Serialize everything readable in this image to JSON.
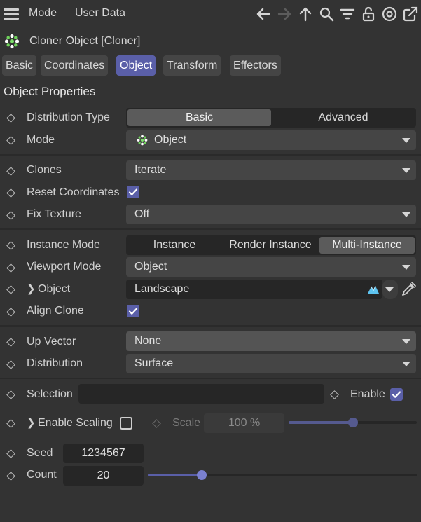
{
  "menu": {
    "mode": "Mode",
    "user_data": "User Data"
  },
  "title": "Cloner Object [Cloner]",
  "tabs": [
    {
      "label": "Basic",
      "active": false
    },
    {
      "label": "Coordinates",
      "active": false
    },
    {
      "label": "Object",
      "active": true
    },
    {
      "label": "Transform",
      "active": false
    },
    {
      "label": "Effectors",
      "active": false
    }
  ],
  "section_title": "Object Properties",
  "props": {
    "distribution_type": {
      "label": "Distribution Type",
      "options": [
        "Basic",
        "Advanced"
      ],
      "selected": "Basic"
    },
    "mode": {
      "label": "Mode",
      "value": "Object"
    },
    "clones": {
      "label": "Clones",
      "value": "Iterate"
    },
    "reset_coordinates": {
      "label": "Reset Coordinates",
      "checked": true
    },
    "fix_texture": {
      "label": "Fix Texture",
      "value": "Off"
    },
    "instance_mode": {
      "label": "Instance Mode",
      "options": [
        "Instance",
        "Render Instance",
        "Multi-Instance"
      ],
      "selected": "Multi-Instance"
    },
    "viewport_mode": {
      "label": "Viewport Mode",
      "value": "Object"
    },
    "object": {
      "label": "Object",
      "value": "Landscape"
    },
    "align_clone": {
      "label": "Align Clone",
      "checked": true
    },
    "up_vector": {
      "label": "Up Vector",
      "value": "None"
    },
    "distribution": {
      "label": "Distribution",
      "value": "Surface"
    },
    "selection": {
      "label": "Selection",
      "value": ""
    },
    "enable": {
      "label": "Enable",
      "checked": true
    },
    "enable_scaling": {
      "label": "Enable Scaling",
      "checked": false
    },
    "scale": {
      "label": "Scale",
      "value": "100 %",
      "level": 0.5
    },
    "seed": {
      "label": "Seed",
      "value": "1234567"
    },
    "count": {
      "label": "Count",
      "value": "20",
      "level": 0.2
    }
  },
  "colors": {
    "accent": "#5a5fa8",
    "background": "#333333",
    "field": "#454545",
    "dark_field": "#262626"
  }
}
